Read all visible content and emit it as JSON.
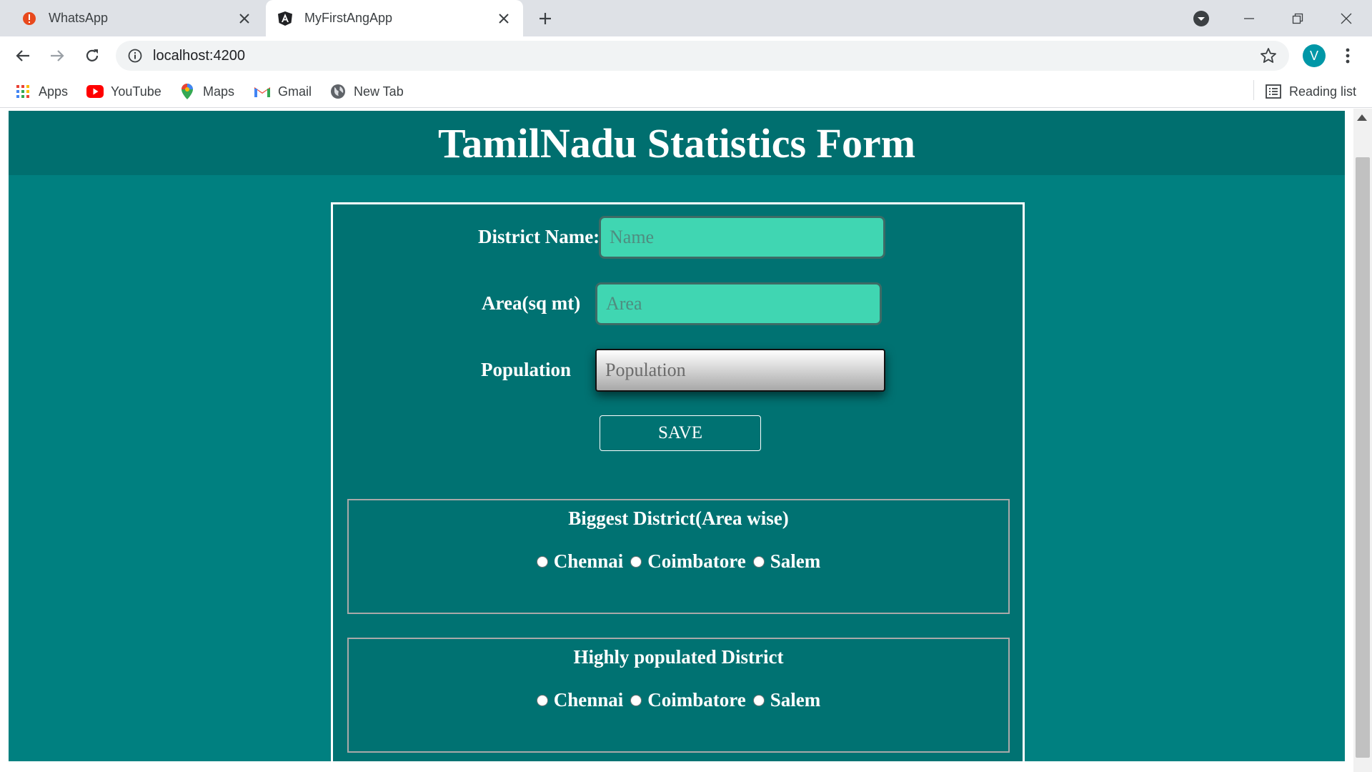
{
  "browser": {
    "tabs": [
      {
        "title": "WhatsApp",
        "active": false,
        "icon": "whatsapp-alert-icon"
      },
      {
        "title": "MyFirstAngApp",
        "active": true,
        "icon": "angular-icon"
      }
    ],
    "url": "localhost:4200",
    "profile_initial": "V",
    "bookmarks": [
      {
        "label": "Apps",
        "icon": "apps-grid-icon"
      },
      {
        "label": "YouTube",
        "icon": "youtube-icon"
      },
      {
        "label": "Maps",
        "icon": "maps-pin-icon"
      },
      {
        "label": "Gmail",
        "icon": "gmail-icon"
      },
      {
        "label": "New Tab",
        "icon": "globe-icon"
      }
    ],
    "reading_list": "Reading list"
  },
  "page": {
    "title": "TamilNadu Statistics Form",
    "form": {
      "district": {
        "label": "District Name:",
        "placeholder": "Name",
        "value": ""
      },
      "area": {
        "label": "Area(sq mt)",
        "colon": ":",
        "placeholder": "Area",
        "value": ""
      },
      "population": {
        "label": "Population",
        "colon": ":",
        "placeholder": "Population",
        "value": ""
      },
      "save_label": "SAVE"
    },
    "biggest": {
      "legend": "Biggest District(Area wise)",
      "options": [
        "Chennai",
        "Coimbatore",
        "Salem"
      ]
    },
    "populated": {
      "legend": "Highly populated District",
      "options": [
        "Chennai",
        "Coimbatore",
        "Salem"
      ]
    }
  },
  "colors": {
    "page_bg": "#008080",
    "header_bg": "#006f6f",
    "input_bg": "#40d6b2"
  }
}
